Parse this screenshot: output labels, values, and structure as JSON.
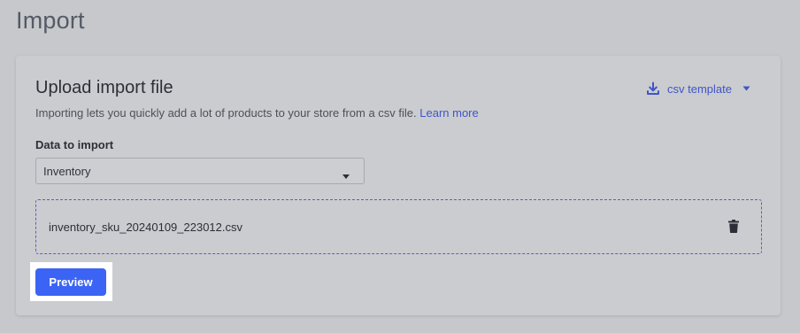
{
  "page": {
    "title": "Import"
  },
  "card": {
    "title": "Upload import file",
    "description": "Importing lets you quickly add a lot of products to your store from a csv file.",
    "learn_more": "Learn more",
    "template_label": "csv template",
    "template_icon": "download-icon"
  },
  "data_to_import": {
    "label": "Data to import",
    "selected": "Inventory"
  },
  "file": {
    "name": "inventory_sku_20240109_223012.csv",
    "delete_icon": "trash-icon"
  },
  "actions": {
    "preview_label": "Preview"
  },
  "colors": {
    "background": "#c7c8cc",
    "card": "#cbcccf",
    "link": "#3f55c9",
    "primary": "#3c64f4",
    "highlight": "#ffffff"
  }
}
